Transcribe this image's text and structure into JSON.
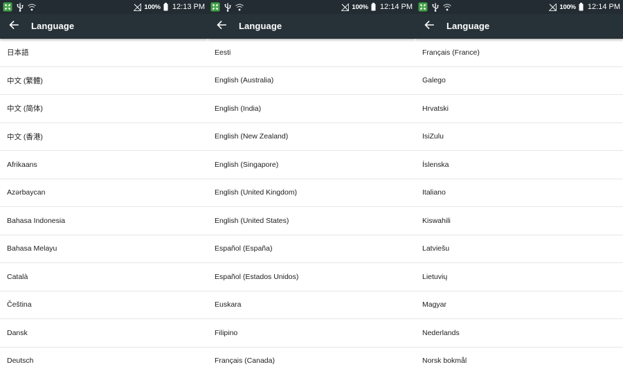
{
  "panels": [
    {
      "status": {
        "battery": "100%",
        "time": "12:13 PM"
      },
      "title": "Language",
      "items": [
        "日本語",
        "中文 (繁體)",
        "中文 (简体)",
        "中文 (香港)",
        "Afrikaans",
        "Azərbaycan",
        "Bahasa Indonesia",
        "Bahasa Melayu",
        "Català",
        "Čeština",
        "Dansk",
        "Deutsch"
      ]
    },
    {
      "status": {
        "battery": "100%",
        "time": "12:14 PM"
      },
      "title": "Language",
      "items": [
        "Eesti",
        "English (Australia)",
        "English (India)",
        "English (New Zealand)",
        "English (Singapore)",
        "English (United Kingdom)",
        "English (United States)",
        "Español (España)",
        "Español (Estados Unidos)",
        "Euskara",
        "Filipino",
        "Français (Canada)"
      ]
    },
    {
      "status": {
        "battery": "100%",
        "time": "12:14 PM"
      },
      "title": "Language",
      "items": [
        "Français (France)",
        "Galego",
        "Hrvatski",
        "IsiZulu",
        "Íslenska",
        "Italiano",
        "Kiswahili",
        "Latviešu",
        "Lietuvių",
        "Magyar",
        "Nederlands",
        "Norsk bokmål"
      ]
    }
  ],
  "icons": {
    "app": "app-notification-icon",
    "usb": "usb-icon",
    "wifi": "wifi-icon",
    "signal": "no-signal-icon",
    "battery": "battery-icon",
    "back": "back-arrow-icon"
  },
  "colors": {
    "statusbar": "#222c32",
    "toolbar": "#263238",
    "app_icon": "#43a047",
    "divider": "#e6e6e6",
    "text": "#202020"
  }
}
